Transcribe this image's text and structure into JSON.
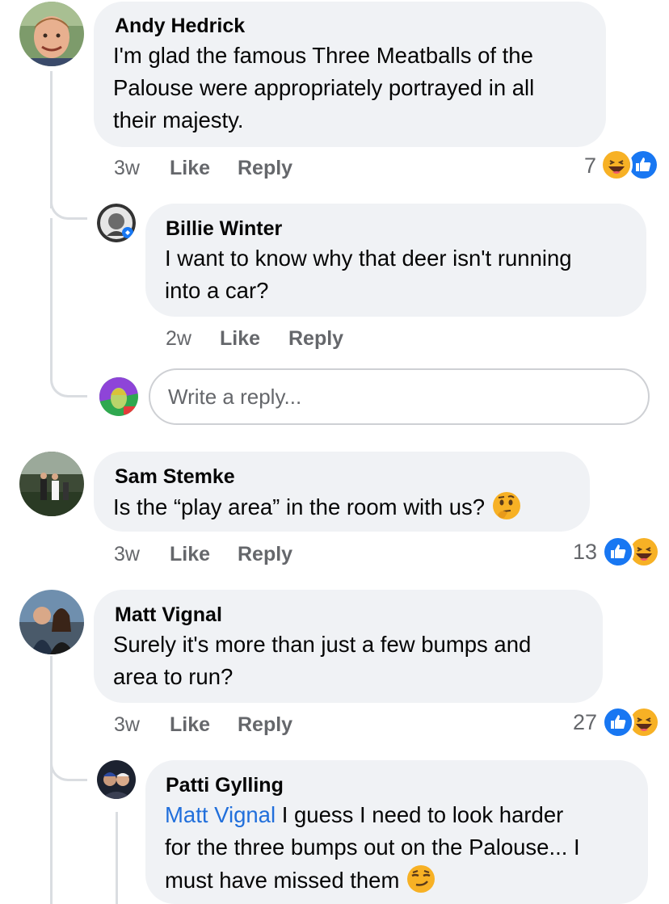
{
  "comments": [
    {
      "author": "Andy Hedrick",
      "lines": [
        "I'm glad the famous Three Meatballs of the",
        "Palouse were appropriately portrayed in all",
        "their majesty."
      ],
      "time": "3w",
      "like": "Like",
      "reply": "Reply",
      "reaction_count": "7",
      "reactions": [
        "haha-icon",
        "like-icon"
      ]
    },
    {
      "author": "Billie Winter",
      "lines": [
        "I want to know why that deer isn't running",
        "into a car?"
      ],
      "time": "2w",
      "like": "Like",
      "reply": "Reply"
    },
    {
      "author": "Sam Stemke",
      "lines": [
        "Is the “play area” in the room with us?"
      ],
      "emoji": "thinking-face-icon",
      "time": "3w",
      "like": "Like",
      "reply": "Reply",
      "reaction_count": "13",
      "reactions": [
        "like-icon",
        "haha-icon"
      ]
    },
    {
      "author": "Matt Vignal",
      "lines": [
        "Surely it's more than just a few bumps and",
        "area to run?"
      ],
      "time": "3w",
      "like": "Like",
      "reply": "Reply",
      "reaction_count": "27",
      "reactions": [
        "like-icon",
        "haha-icon"
      ]
    },
    {
      "author": "Patti Gylling",
      "mention": "Matt Vignal",
      "lines": [
        " I guess I need to look harder",
        "for the three bumps out on the Palouse... I",
        "must have missed them"
      ],
      "emoji": "smirking-face-icon"
    }
  ],
  "reply_box": {
    "placeholder": "Write a reply..."
  },
  "colors": {
    "bubble": "#f0f2f5",
    "meta_text": "#65676b",
    "mention": "#216fdb",
    "like_blue": "#1877f2",
    "thread_line": "#dadde1"
  }
}
